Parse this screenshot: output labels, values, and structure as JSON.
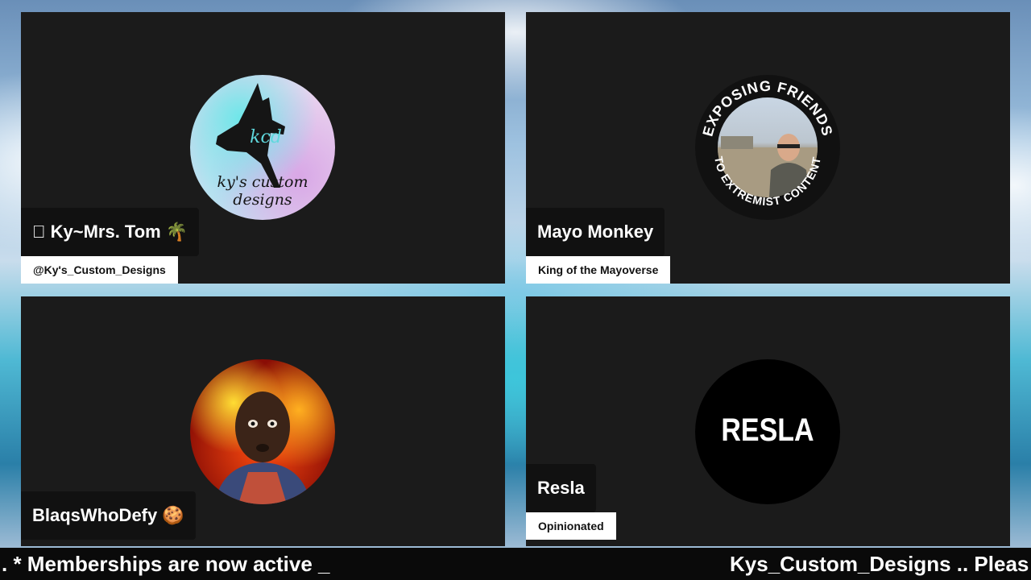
{
  "participants": [
    {
      "name": "\u0000 Ky~Mrs. Tom 🌴",
      "subtitle": "@Ky's_Custom_Designs",
      "avatar_text": "ky's custom designs",
      "avatar_mark": "kcd"
    },
    {
      "name": "Mayo Monkey",
      "subtitle": "King of the Mayoverse",
      "avatar_ring_top": "EXPOSING FRIENDS",
      "avatar_ring_bottom": "TO EXTREMIST CONTENT"
    },
    {
      "name": "BlaqsWhoDefy 🍪"
    },
    {
      "name": "Resla",
      "subtitle": "Opinionated",
      "avatar_text": "RESLA"
    }
  ],
  "ticker": {
    "left": ". * Memberships are now active _",
    "right": "Kys_Custom_Designs .. Pleas"
  },
  "colors": {
    "tile_bg": "#1b1b1b",
    "nameplate_bg": "#111111",
    "subplate_bg": "#ffffff",
    "ticker_bg": "#0a0a0a"
  }
}
